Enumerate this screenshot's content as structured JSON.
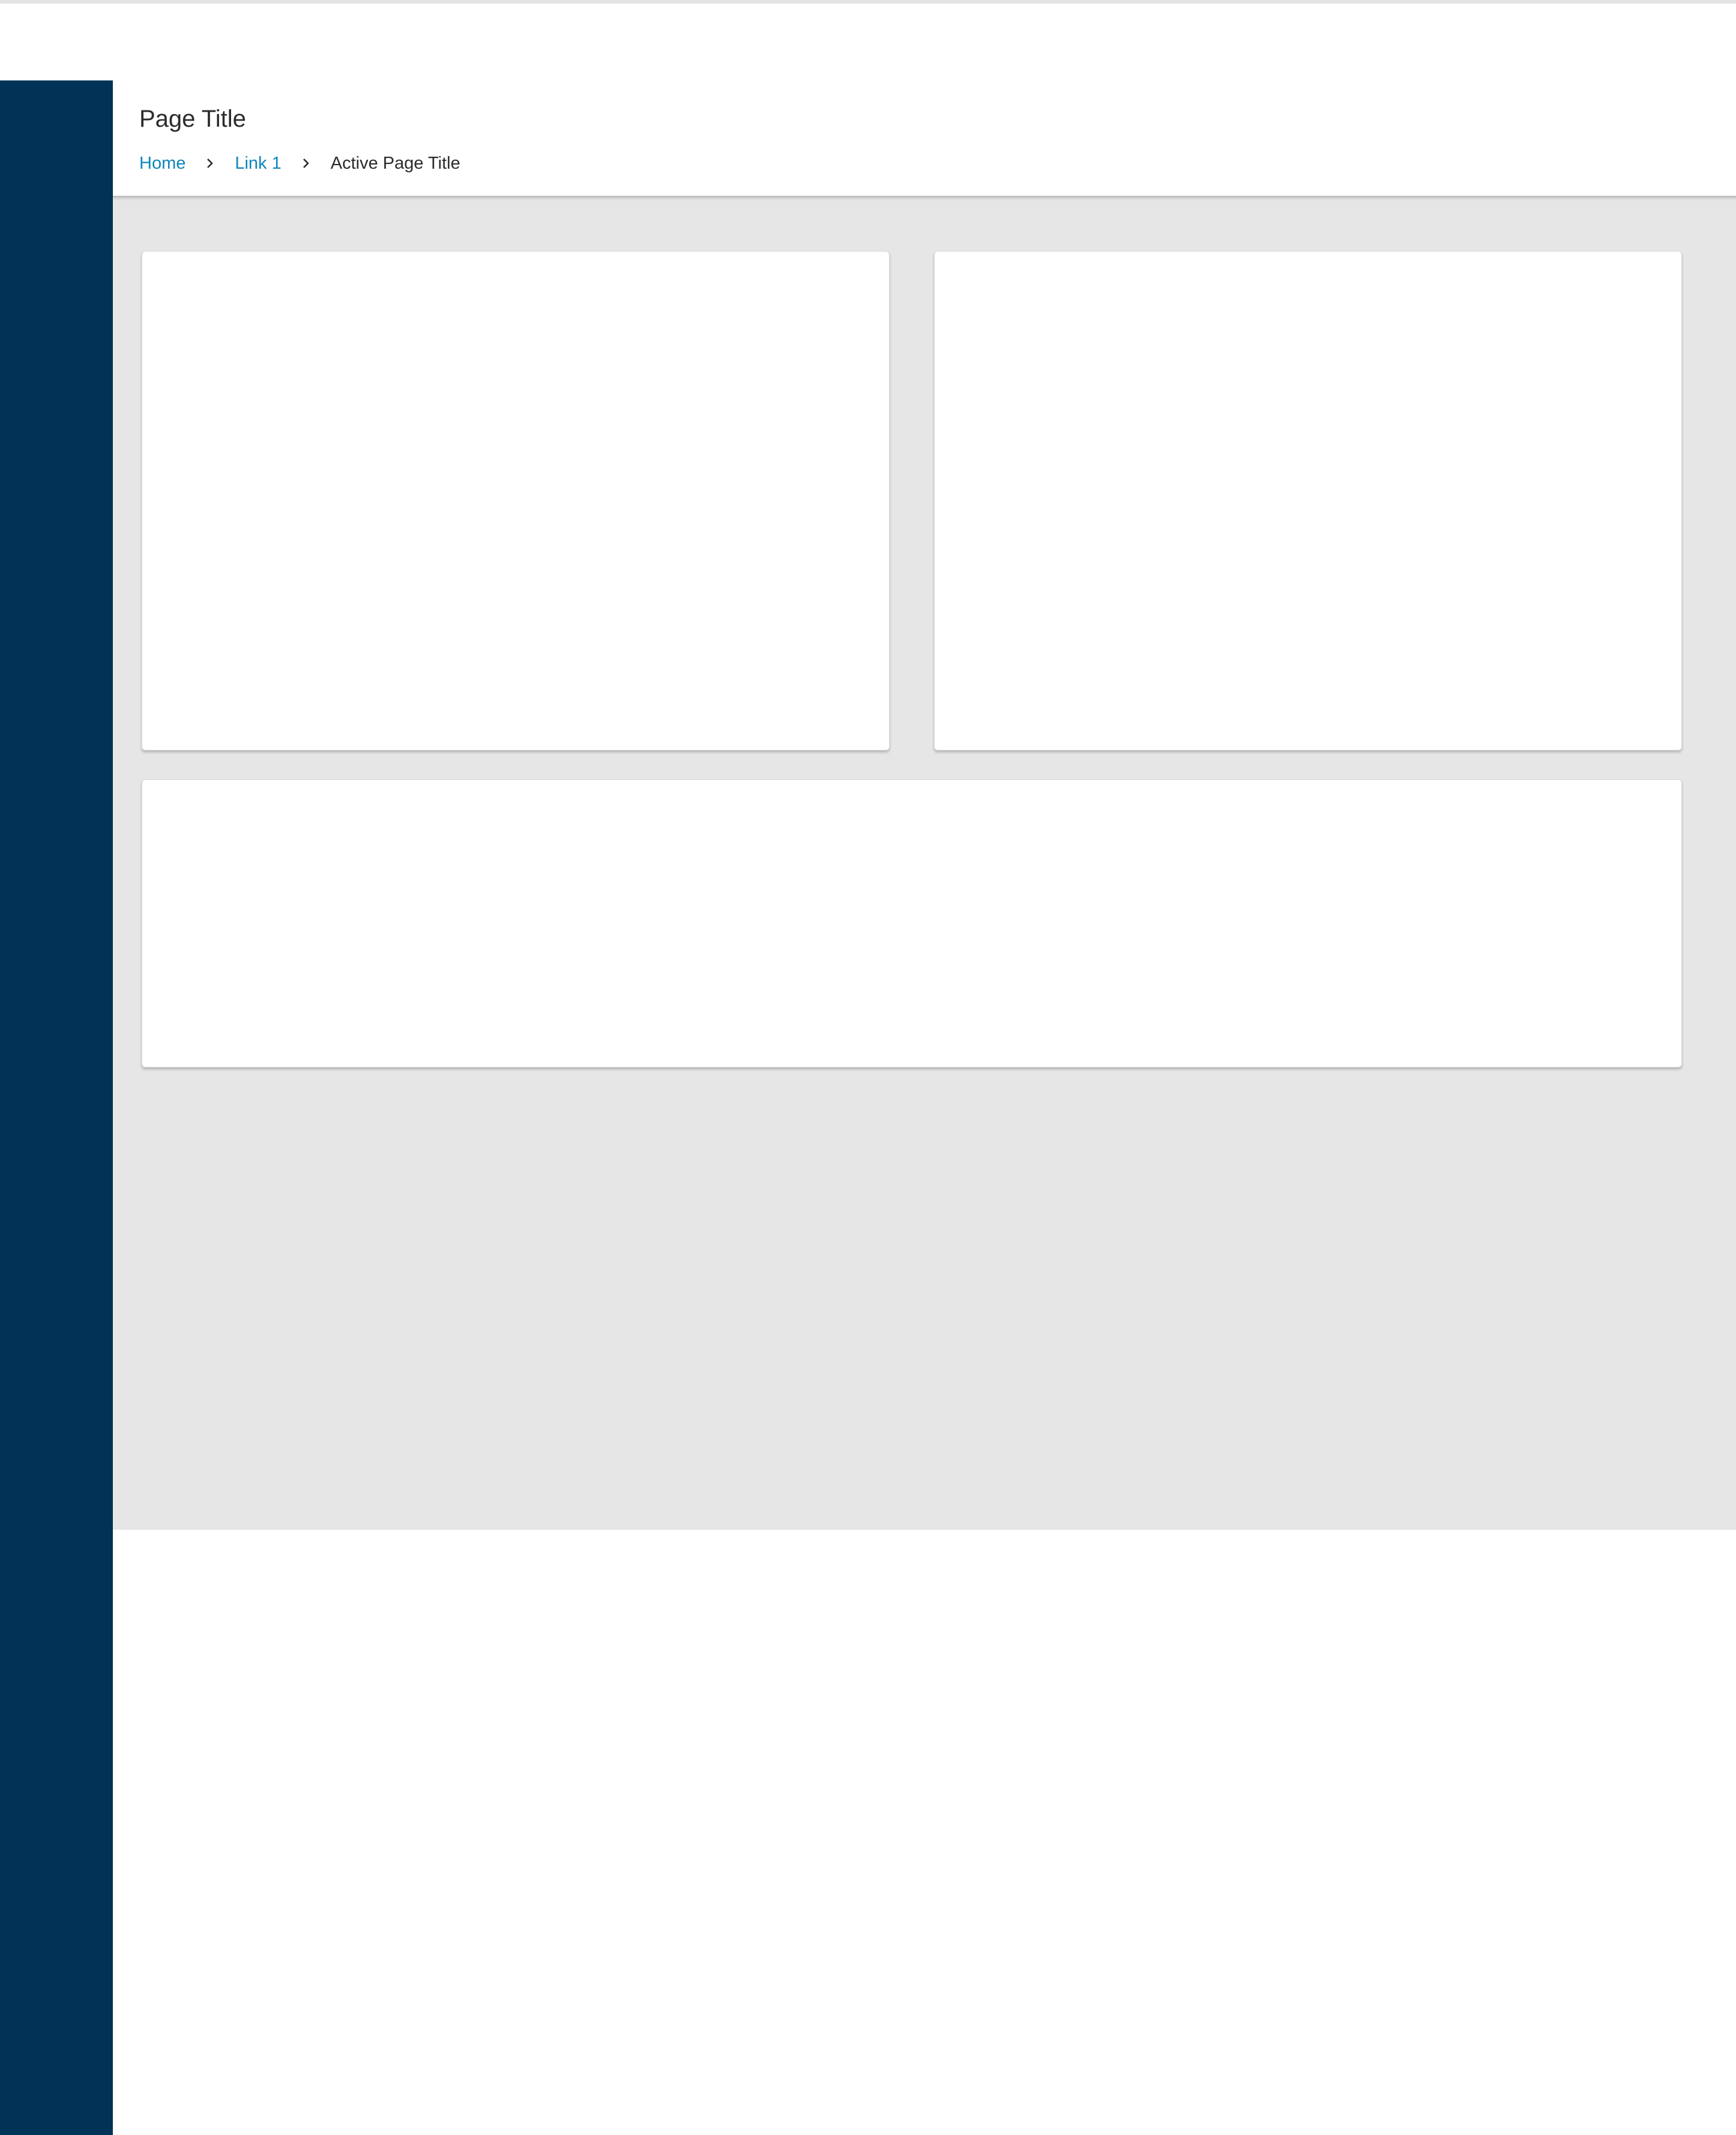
{
  "header": {
    "title": "Page Title"
  },
  "breadcrumb": {
    "items": [
      {
        "label": "Home"
      },
      {
        "label": "Link 1"
      }
    ],
    "current": "Active Page Title",
    "separator_icon": "chevron-right-icon"
  },
  "colors": {
    "sidebar": "#003356",
    "link": "#0e86b8",
    "content_background": "#e6e6e6",
    "card_background": "#ffffff",
    "text": "#2b2b2b"
  }
}
